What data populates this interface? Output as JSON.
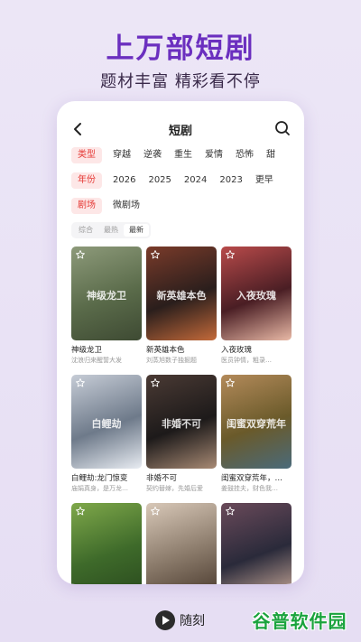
{
  "hero": {
    "title": "上万部短剧",
    "subtitle": "题材丰富 精彩看不停"
  },
  "header": {
    "title": "短剧"
  },
  "filters": {
    "type": {
      "key": "类型",
      "options": [
        "穿越",
        "逆袭",
        "重生",
        "爱情",
        "恐怖",
        "甜"
      ]
    },
    "year": {
      "key": "年份",
      "options": [
        "2026",
        "2025",
        "2024",
        "2023",
        "更早"
      ]
    },
    "theater": {
      "key": "剧场",
      "options": [
        "微剧场"
      ]
    }
  },
  "sort": {
    "options": [
      "综合",
      "最热",
      "最新"
    ],
    "selected": "最新"
  },
  "cards": [
    {
      "title": "神级龙卫",
      "desc": "沈浪归来醒誓大发",
      "poster_text": "神级龙卫",
      "colors": [
        "#5a6b4a",
        "#8d9a7a",
        "#3e4a33"
      ]
    },
    {
      "title": "新英雄本色",
      "desc": "刘蒸旭数子独掘题",
      "poster_text": "新英雄本色",
      "colors": [
        "#2a1e1c",
        "#7a3b2a",
        "#c46a3a"
      ]
    },
    {
      "title": "入夜玫瑰",
      "desc": "医员钟情，粗录…",
      "poster_text": "入夜玫瑰",
      "colors": [
        "#4a1e24",
        "#b84a4a",
        "#e9b9a6"
      ]
    },
    {
      "title": "白鲤劫:龙门惊变",
      "desc": "庙娟真身，是万龙…",
      "poster_text": "白鲤劫",
      "colors": [
        "#6e7a8a",
        "#c6ccd6",
        "#e8ecf2"
      ]
    },
    {
      "title": "非婚不可",
      "desc": "契约替嫁，先婚后爱",
      "poster_text": "非婚不可",
      "colors": [
        "#1d1a1a",
        "#4a3a34",
        "#a88a74"
      ]
    },
    {
      "title": "闺蜜双穿荒年，…",
      "desc": "姜鼓挂夫，财色我…",
      "poster_text": "闺蜜双穿荒年",
      "colors": [
        "#6a5a2a",
        "#b38a5a",
        "#4a6a7a"
      ]
    },
    {
      "title": "",
      "desc": "",
      "poster_text": "",
      "colors": [
        "#3e6a2a",
        "#7fa84a",
        "#2a4a1e"
      ]
    },
    {
      "title": "",
      "desc": "",
      "poster_text": "",
      "colors": [
        "#8a7a6a",
        "#d8c8b8",
        "#4a3a2e"
      ]
    },
    {
      "title": "",
      "desc": "",
      "poster_text": "",
      "colors": [
        "#2a2a3a",
        "#6a4a5a",
        "#c8a898"
      ]
    }
  ],
  "brand": {
    "name": "随刻"
  },
  "watermark": {
    "text": "谷普软件园"
  }
}
